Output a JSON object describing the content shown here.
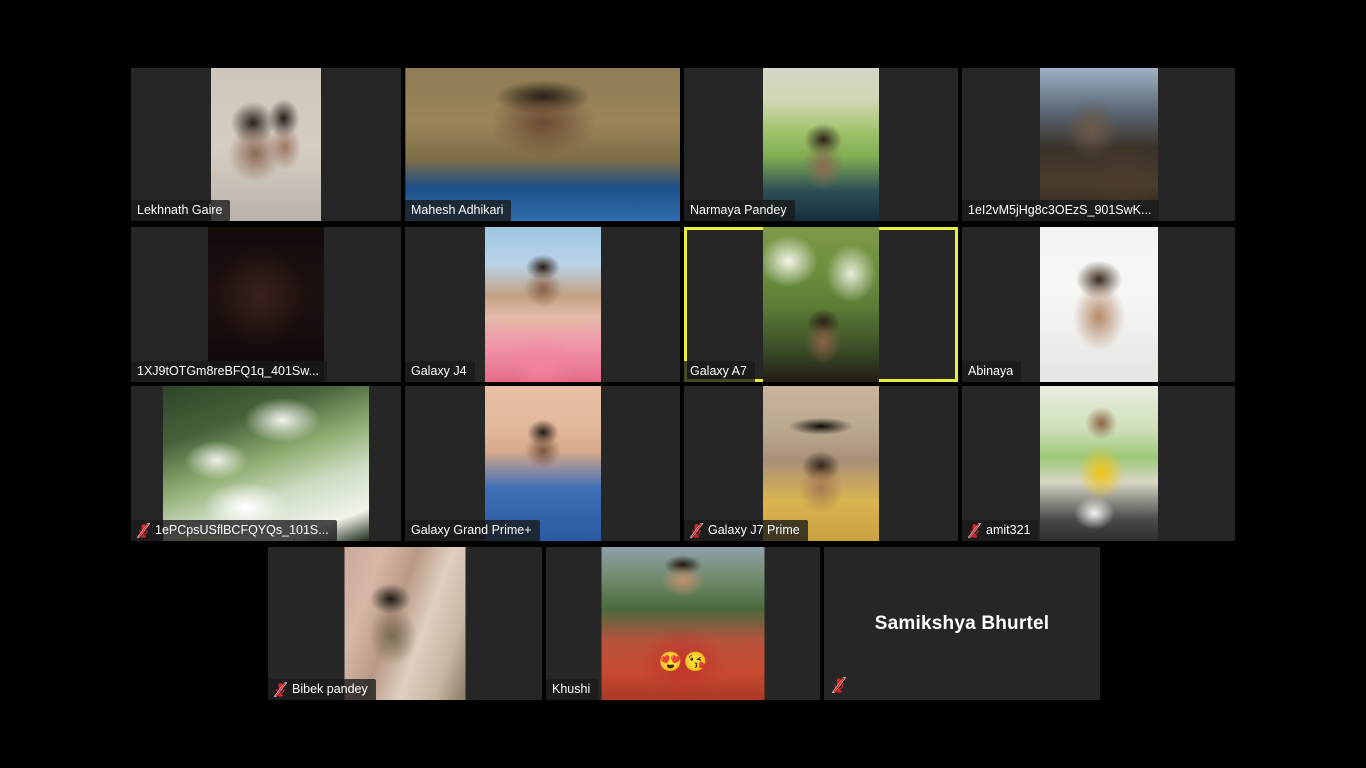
{
  "app": {
    "title": "Video Conference Gallery View",
    "background_color": "#000000",
    "tile_background_color": "#262626",
    "active_speaker_border_color": "#e9f03c",
    "muted_icon_color": "#d6262b",
    "label_text_color": "#ffffff"
  },
  "icons": {
    "muted_mic": "mic-muted-icon"
  },
  "grid": {
    "rows": [
      {
        "row_index": 1,
        "tiles": [
          {
            "id": "tile-1",
            "name": "Lekhnath Gaire",
            "muted": false,
            "active_speaker": false,
            "has_video": true,
            "name_display": "label",
            "video_style": "v-lekhnath",
            "video_width": 110
          },
          {
            "id": "tile-2",
            "name": "Mahesh Adhikari",
            "muted": false,
            "active_speaker": false,
            "has_video": true,
            "name_display": "label",
            "video_style": "v-mahesh",
            "video_width": 275
          },
          {
            "id": "tile-3",
            "name": "Narmaya Pandey",
            "muted": false,
            "active_speaker": false,
            "has_video": true,
            "name_display": "label",
            "video_style": "v-narmaya",
            "video_width": 116
          },
          {
            "id": "tile-4",
            "name": "1eI2vM5jHg8c3OEzS_901SwK...",
            "muted": false,
            "active_speaker": false,
            "has_video": true,
            "name_display": "label",
            "video_style": "v-1el2",
            "video_width": 118
          }
        ]
      },
      {
        "row_index": 2,
        "tiles": [
          {
            "id": "tile-5",
            "name": "1XJ9tOTGm8reBFQ1q_401Sw...",
            "muted": false,
            "active_speaker": false,
            "has_video": true,
            "name_display": "label",
            "video_style": "v-dark-red",
            "video_width": 116
          },
          {
            "id": "tile-6",
            "name": "Galaxy J4",
            "muted": false,
            "active_speaker": false,
            "has_video": true,
            "name_display": "label",
            "video_style": "v-galaxyj4",
            "video_width": 116
          },
          {
            "id": "tile-7",
            "name": "Galaxy A7",
            "muted": false,
            "active_speaker": true,
            "has_video": true,
            "name_display": "label",
            "video_style": "v-galaxya7",
            "video_width": 116
          },
          {
            "id": "tile-8",
            "name": "Abinaya",
            "muted": false,
            "active_speaker": false,
            "has_video": true,
            "name_display": "label",
            "video_style": "v-abinaya",
            "video_width": 118
          }
        ]
      },
      {
        "row_index": 3,
        "tiles": [
          {
            "id": "tile-9",
            "name": "1ePCpsUSflBCFQYQs_101S...",
            "muted": true,
            "active_speaker": false,
            "has_video": true,
            "name_display": "label",
            "video_style": "v-tree",
            "video_width": 206
          },
          {
            "id": "tile-10",
            "name": "Galaxy Grand Prime+",
            "muted": false,
            "active_speaker": false,
            "has_video": true,
            "name_display": "label",
            "video_style": "v-grandprime",
            "video_width": 116
          },
          {
            "id": "tile-11",
            "name": "Galaxy J7 Prime",
            "muted": true,
            "active_speaker": false,
            "has_video": true,
            "name_display": "label",
            "video_style": "v-j7prime",
            "video_width": 116
          },
          {
            "id": "tile-12",
            "name": "amit321",
            "muted": true,
            "active_speaker": false,
            "has_video": true,
            "name_display": "label",
            "video_style": "v-amit",
            "video_width": 118
          }
        ]
      },
      {
        "row_index": 4,
        "tiles": [
          {
            "id": "tile-13",
            "name": "Bibek pandey",
            "muted": true,
            "active_speaker": false,
            "has_video": true,
            "name_display": "label",
            "video_style": "v-bibek",
            "video_width": 121
          },
          {
            "id": "tile-14",
            "name": "Khushi",
            "muted": false,
            "active_speaker": false,
            "has_video": true,
            "name_display": "label",
            "video_style": "v-khushi",
            "video_width": 163,
            "reactions": [
              "😍",
              "😘"
            ]
          },
          {
            "id": "tile-15",
            "name": "Samikshya Bhurtel",
            "muted": true,
            "active_speaker": false,
            "has_video": false,
            "name_display": "center",
            "video_style": "v-blank",
            "video_width": 0
          }
        ]
      }
    ]
  },
  "participant_names": [
    "Lekhnath Gaire",
    "Mahesh Adhikari",
    "Narmaya Pandey",
    "1eI2vM5jHg8c3OEzS_901SwK...",
    "1XJ9tOTGm8reBFQ1q_401Sw...",
    "Galaxy J4",
    "Galaxy A7",
    "Abinaya",
    "1ePCpsUSflBCFQYQs_101S...",
    "Galaxy Grand Prime+",
    "Galaxy J7 Prime",
    "amit321",
    "Bibek pandey",
    "Khushi",
    "Samikshya Bhurtel"
  ]
}
